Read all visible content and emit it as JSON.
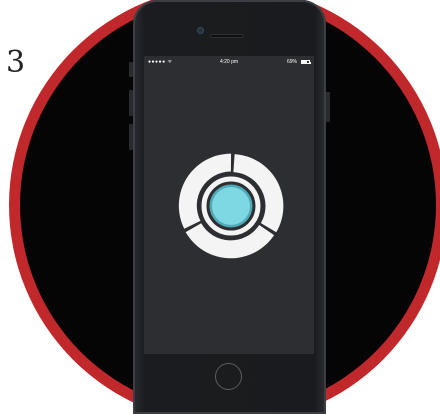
{
  "step": {
    "number": "3"
  },
  "colors": {
    "badge_red": "#c0282b",
    "badge_fill": "#050505",
    "screen_bg": "#2c2e31",
    "ring": "#f4f4f4",
    "center_glow": "#7dd8e3"
  },
  "status_bar": {
    "signal": "●●●●● ᯤ",
    "time": "4:20 pm",
    "battery": "69%",
    "battery_level": 0.69
  },
  "icons": {
    "camera": "front-camera-icon",
    "speaker": "speaker-grille-icon",
    "home": "home-button-icon",
    "sensor": "segmented-ring-sensor-icon"
  }
}
